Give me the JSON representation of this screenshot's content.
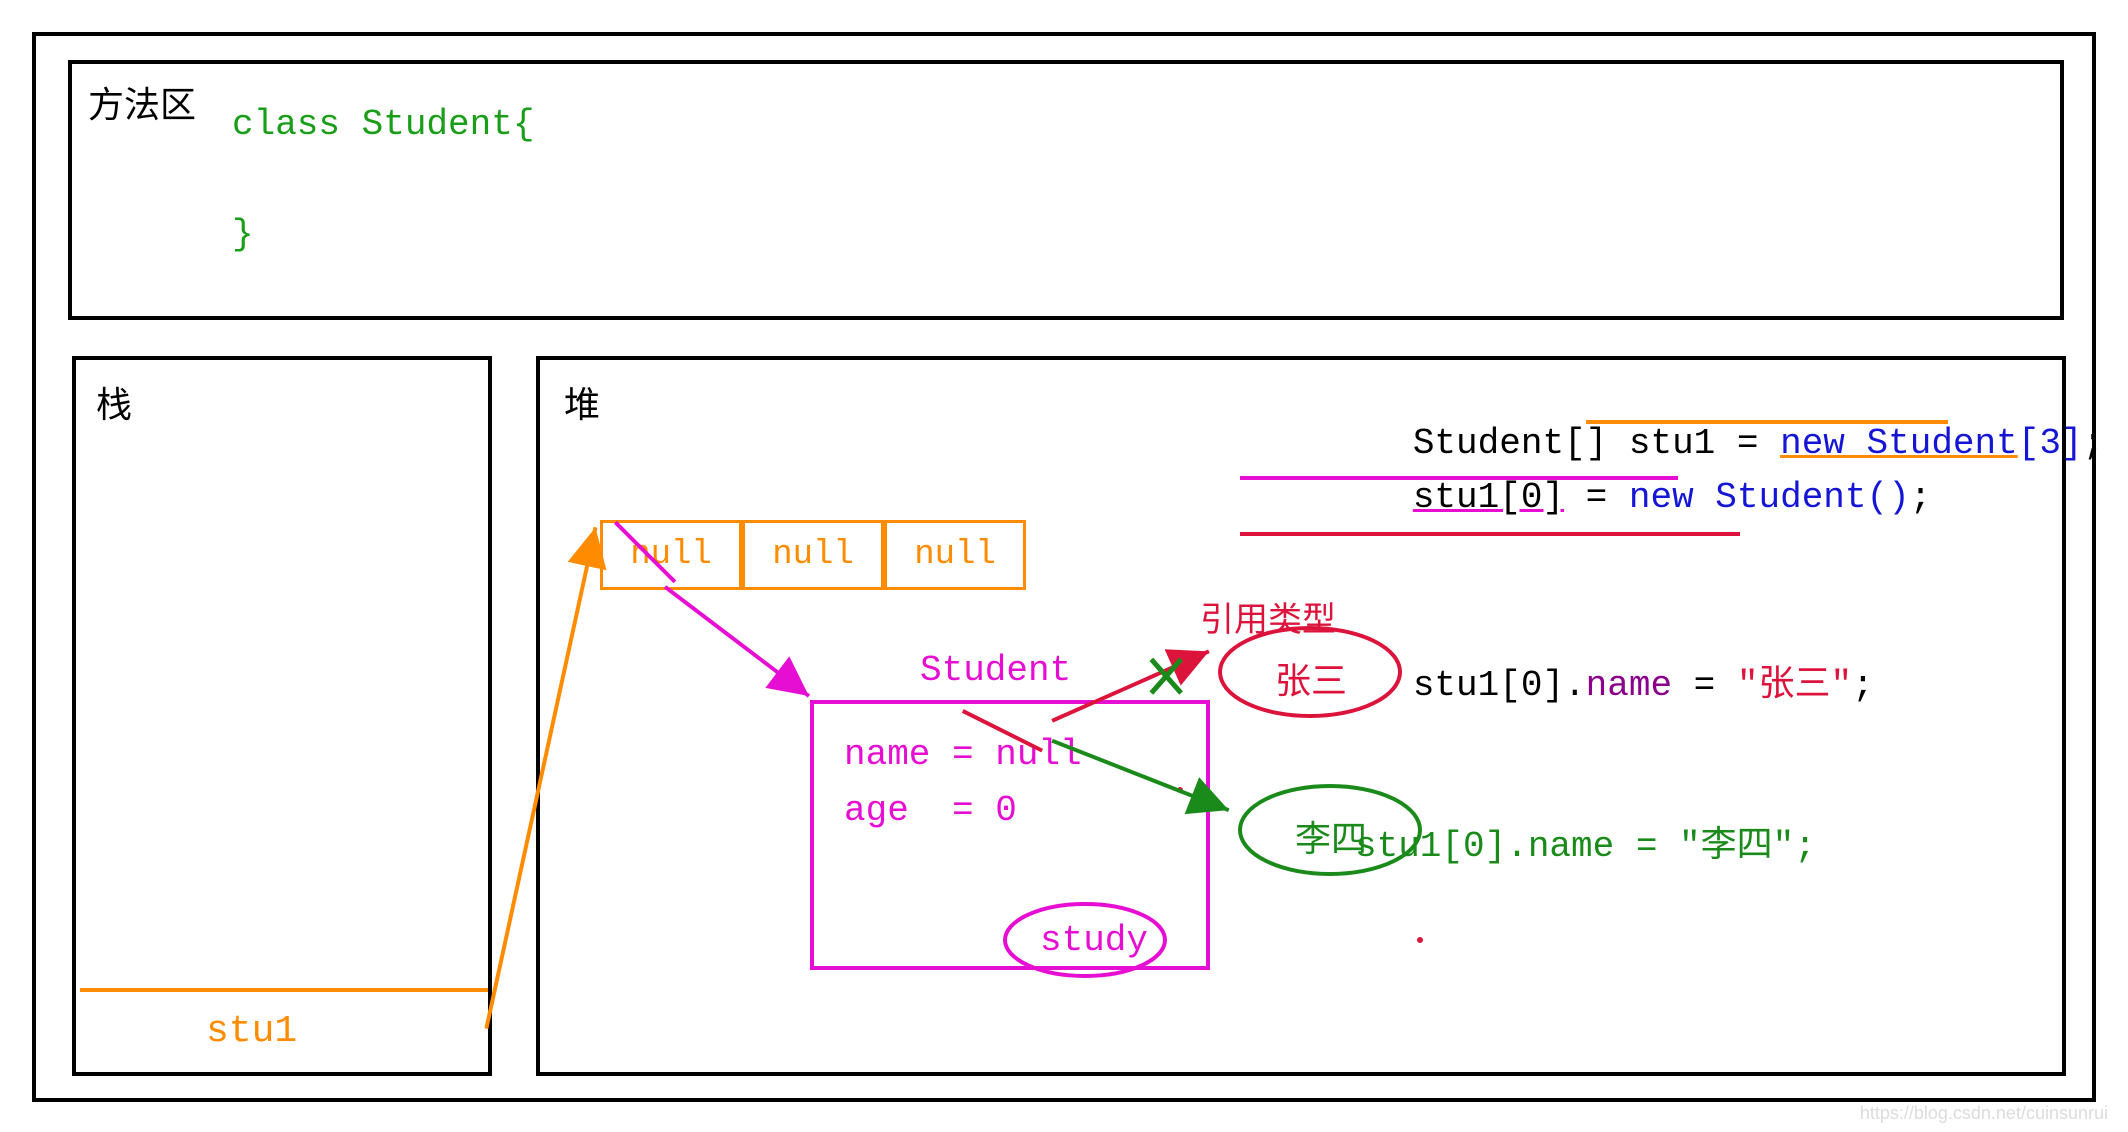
{
  "labels": {
    "method_area": "方法区",
    "stack": "栈",
    "heap": "堆",
    "stu1": "stu1",
    "student": "Student",
    "reference_type": "引用类型",
    "zhangsan": "张三",
    "lisi": "李四",
    "study": "study"
  },
  "method_code": {
    "line1": "class Student{",
    "line2": "}"
  },
  "array_cells": [
    "null",
    "null",
    "null"
  ],
  "student_fields": {
    "name": "name = null",
    "age": "age  = 0"
  },
  "code": {
    "l1a": "Student[] stu1 = ",
    "l1b": "new Student",
    "l1c": "[3]",
    "l1d": ";",
    "l2a": "stu1[0]",
    "l2b": " = ",
    "l2c": "new Student()",
    "l2d": ";",
    "l3a": "stu1[0].",
    "l3b": "name",
    "l3c": " = ",
    "l3d": "\"张三\"",
    "l3e": ";",
    "l4": "stu1[0].name = \"李四\";"
  },
  "colors": {
    "orange": "#ff8c00",
    "magenta": "#e60ed2",
    "green": "#1a9e1a",
    "blue": "#1515d6",
    "crimson": "#dc143c",
    "darkgreen": "#1a8a1a"
  },
  "watermark": "https://blog.csdn.net/cuinsunrui"
}
